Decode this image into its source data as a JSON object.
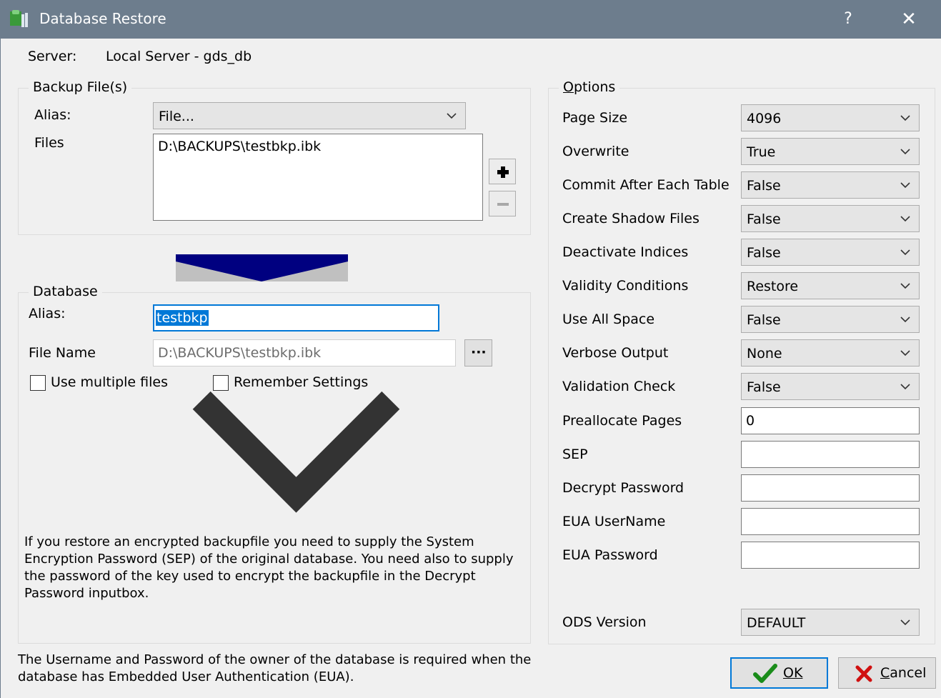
{
  "window": {
    "title": "Database Restore",
    "help_label": "?",
    "close_label": "✕"
  },
  "server": {
    "label": "Server:",
    "value": "Local Server - gds_db"
  },
  "backup": {
    "group_label": "Backup File(s)",
    "alias_label": "Alias:",
    "alias_value": "File...",
    "files_label": "Files",
    "files": [
      "D:\\BACKUPS\\testbkp.ibk"
    ]
  },
  "database": {
    "group_label": "Database",
    "alias_label": "Alias:",
    "alias_value": "testbkp",
    "filename_label": "File Name",
    "filename_value": "D:\\BACKUPS\\testbkp.ibk",
    "browse_label": "···",
    "use_multiple_files": {
      "label": "Use multiple files",
      "checked": false
    },
    "remember_settings": {
      "label": "Remember Settings",
      "checked": false
    }
  },
  "notes": {
    "encryption": "If you restore an encrypted backupfile you need to supply the System Encryption Password (SEP) of the original database. You need also to supply the password of the key used to encrypt the backupfile  in the Decrypt Password inputbox.",
    "eua": "The Username and Password of the owner of the database is required when the database has Embedded User Authentication (EUA)."
  },
  "options": {
    "group_label": "Options",
    "page_size": {
      "label": "Page Size",
      "value": "4096"
    },
    "overwrite": {
      "label": "Overwrite",
      "value": "True"
    },
    "commit_after_each_table": {
      "label": "Commit After Each Table",
      "value": "False"
    },
    "create_shadow_files": {
      "label": "Create Shadow Files",
      "value": "False"
    },
    "deactivate_indices": {
      "label": "Deactivate Indices",
      "value": "False"
    },
    "validity_conditions": {
      "label": "Validity Conditions",
      "value": "Restore"
    },
    "use_all_space": {
      "label": "Use All Space",
      "value": "False"
    },
    "verbose_output": {
      "label": "Verbose Output",
      "value": "None"
    },
    "validation_check": {
      "label": "Validation Check",
      "value": "False"
    },
    "preallocate_pages": {
      "label": "Preallocate Pages",
      "value": "0"
    },
    "sep": {
      "label": "SEP",
      "value": ""
    },
    "decrypt_password": {
      "label": "Decrypt Password",
      "value": ""
    },
    "eua_username": {
      "label": "EUA UserName",
      "value": ""
    },
    "eua_password": {
      "label": "EUA Password",
      "value": ""
    },
    "ods_version": {
      "label": "ODS Version",
      "value": "DEFAULT"
    }
  },
  "buttons": {
    "ok": "OK",
    "cancel": "Cancel"
  },
  "colors": {
    "titlebar": "#6d7d8d",
    "arrow": "#000080",
    "selection": "#0078d7",
    "focus_border": "#0078d7"
  },
  "icons": [
    "app-icon",
    "help-icon",
    "close-icon",
    "add-icon",
    "remove-icon",
    "chevron-down-icon",
    "checkmark-icon",
    "cancel-x-icon"
  ]
}
